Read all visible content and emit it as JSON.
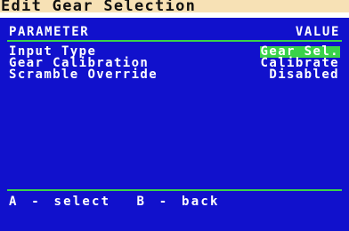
{
  "title": "Edit Gear Selection",
  "header": {
    "parameter": "PARAMETER",
    "value": "VALUE"
  },
  "rows": [
    {
      "label": "Input Type",
      "value": "Gear Sel.",
      "selected": true
    },
    {
      "label": "Gear Calibration",
      "value": "Calibrate",
      "selected": false
    },
    {
      "label": "Scramble Override",
      "value": "Disabled",
      "selected": false
    }
  ],
  "footer": {
    "hint": "A - select  B - back"
  },
  "colors": {
    "background": "#1111cc",
    "accent_green": "#3ad24a",
    "title_bar": "#ffffff",
    "title_tint": "#f0c878",
    "text": "#ffffff"
  }
}
